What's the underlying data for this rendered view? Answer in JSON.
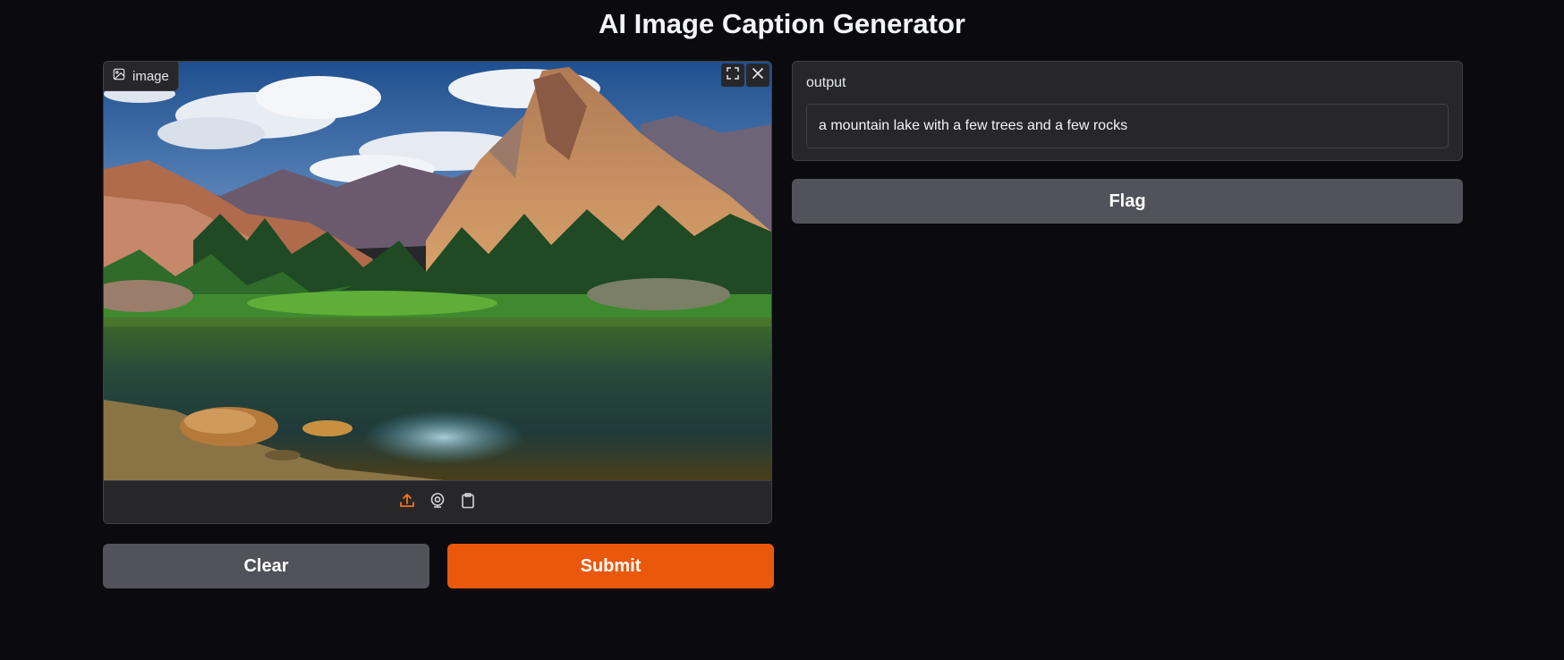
{
  "app": {
    "title": "AI Image Caption Generator"
  },
  "input_image": {
    "label": "image",
    "label_icon": "image-icon",
    "tools": [
      {
        "icon": "fullscreen-icon"
      },
      {
        "icon": "close-icon"
      }
    ],
    "sources": [
      {
        "icon": "upload-icon",
        "active": true
      },
      {
        "icon": "webcam-icon",
        "active": false
      },
      {
        "icon": "clipboard-icon",
        "active": false
      }
    ]
  },
  "actions": {
    "clear_label": "Clear",
    "submit_label": "Submit"
  },
  "output": {
    "label": "output",
    "value": "a mountain lake with a few trees and a few rocks"
  },
  "flag": {
    "label": "Flag"
  },
  "colors": {
    "background": "#0b0b0f",
    "panel": "#27272a",
    "border": "#3f3f46",
    "secondary_button": "#52525b",
    "primary_button": "#ea580c",
    "active_source_icon": "#f97316"
  }
}
